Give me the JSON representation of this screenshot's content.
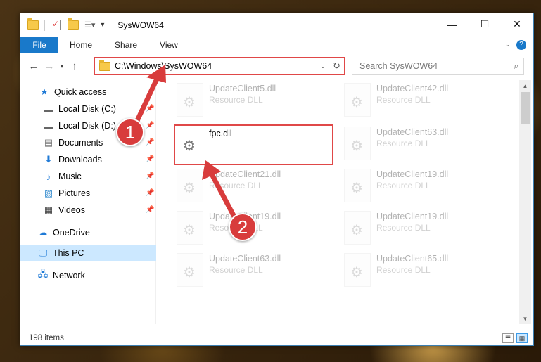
{
  "window": {
    "title": "SysWOW64"
  },
  "ribbon": {
    "tabs": [
      "File",
      "Home",
      "Share",
      "View"
    ]
  },
  "nav": {
    "address": "C:\\Windows\\SysWOW64",
    "search_placeholder": "Search SysWOW64"
  },
  "sidebar": {
    "items": [
      {
        "label": "Quick access",
        "icon": "star-icon"
      },
      {
        "label": "Local Disk (C:)",
        "icon": "drive-icon",
        "pinned": true
      },
      {
        "label": "Local Disk (D:)",
        "icon": "drive-icon",
        "pinned": true
      },
      {
        "label": "Documents",
        "icon": "documents-icon",
        "pinned": true
      },
      {
        "label": "Downloads",
        "icon": "download-icon",
        "pinned": true
      },
      {
        "label": "Music",
        "icon": "music-icon",
        "pinned": true
      },
      {
        "label": "Pictures",
        "icon": "pictures-icon",
        "pinned": true
      },
      {
        "label": "Videos",
        "icon": "videos-icon",
        "pinned": true
      },
      {
        "label": "OneDrive",
        "icon": "cloud-icon"
      },
      {
        "label": "This PC",
        "icon": "computer-icon",
        "selected": true
      },
      {
        "label": "Network",
        "icon": "network-icon"
      }
    ]
  },
  "files": [
    {
      "name": "UpdateClient5.dll",
      "desc": "Resource DLL",
      "faded": true
    },
    {
      "name": "UpdateClient42.dll",
      "desc": "Resource DLL",
      "faded": true
    },
    {
      "name": "fpc.dll",
      "desc": "",
      "faded": false,
      "highlighted": true
    },
    {
      "name": "UpdateClient63.dll",
      "desc": "Resource DLL",
      "faded": true
    },
    {
      "name": "UpdateClient21.dll",
      "desc": "Resource DLL",
      "faded": true
    },
    {
      "name": "UpdateClient19.dll",
      "desc": "Resource DLL",
      "faded": true
    },
    {
      "name": "UpdateClient19.dll",
      "desc": "Resource DLL",
      "faded": true
    },
    {
      "name": "UpdateClient19.dll",
      "desc": "Resource DLL",
      "faded": true
    },
    {
      "name": "UpdateClient63.dll",
      "desc": "Resource DLL",
      "faded": true
    },
    {
      "name": "UpdateClient65.dll",
      "desc": "Resource DLL",
      "faded": true
    }
  ],
  "status": {
    "items": "198 items"
  },
  "annotations": {
    "badge1": "1",
    "badge2": "2",
    "color": "#d83c3c"
  }
}
